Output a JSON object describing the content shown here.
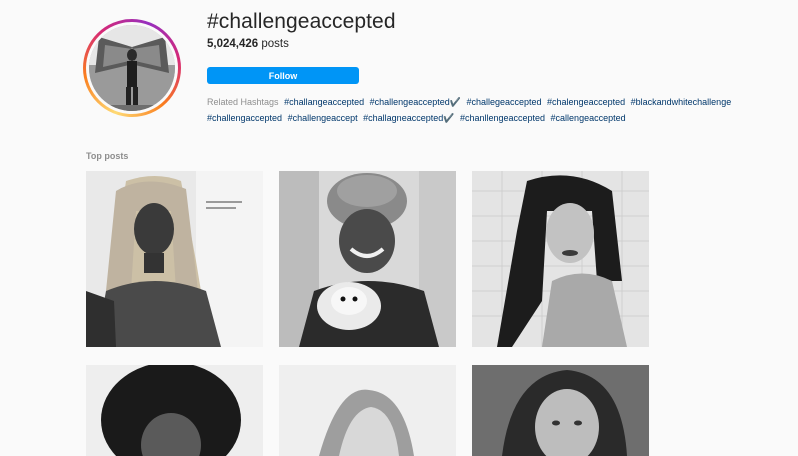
{
  "hashtag": {
    "title": "#challengeaccepted",
    "post_count": "5,024,426",
    "post_count_suffix": " posts",
    "follow_label": "Follow"
  },
  "related": {
    "label": "Related Hashtags",
    "hashtags": [
      "#challangeaccepted",
      "#challengeaccepted✔️",
      "#challegeaccepted",
      "#chalengeaccepted",
      "#blackandwhitechallenge",
      "#challengaccepted",
      "#challengeaccept",
      "#challagneaccepted✔️",
      "#chanllengeaccepted",
      "#callengeaccepted"
    ]
  },
  "top_posts": {
    "title": "Top posts",
    "posts": [
      {
        "image": "black-and-white-selfie-woman-long-straight-hair"
      },
      {
        "image": "black-and-white-selfie-woman-head-wrap-with-dog"
      },
      {
        "image": "black-and-white-selfie-woman-braids"
      },
      {
        "image": "black-and-white-portrait-woman-curly-hair"
      },
      {
        "image": "black-and-white-portrait-woman-wavy-hair"
      },
      {
        "image": "black-and-white-portrait-long-hair"
      }
    ]
  }
}
